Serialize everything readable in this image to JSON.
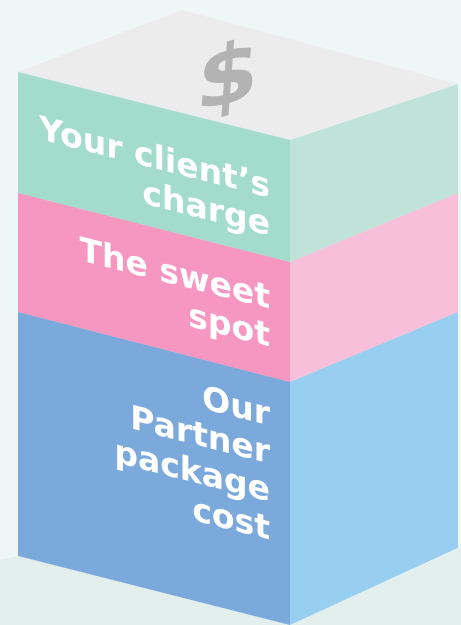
{
  "diagram": {
    "top_icon": "dollar-sign-icon",
    "layers": [
      {
        "key": "client_charge",
        "lines": [
          "Your client’s",
          "charge"
        ]
      },
      {
        "key": "sweet_spot",
        "lines": [
          "The sweet",
          "spot"
        ]
      },
      {
        "key": "partner_cost",
        "lines": [
          "Our",
          "Partner",
          "package",
          "cost"
        ]
      }
    ]
  },
  "colors": {
    "background": "#eef7f5",
    "floor_shadow": "#e3efec",
    "top_face": "#ececec",
    "dollar_sign": "#b3b3b3",
    "green_front": "#a3dccc",
    "green_side": "#bfe3d9",
    "pink_front": "#f597c0",
    "pink_side": "#f7bfd9",
    "blue_front": "#7ba9dc",
    "blue_side": "#98cef0",
    "label_text": "#ffffff"
  }
}
